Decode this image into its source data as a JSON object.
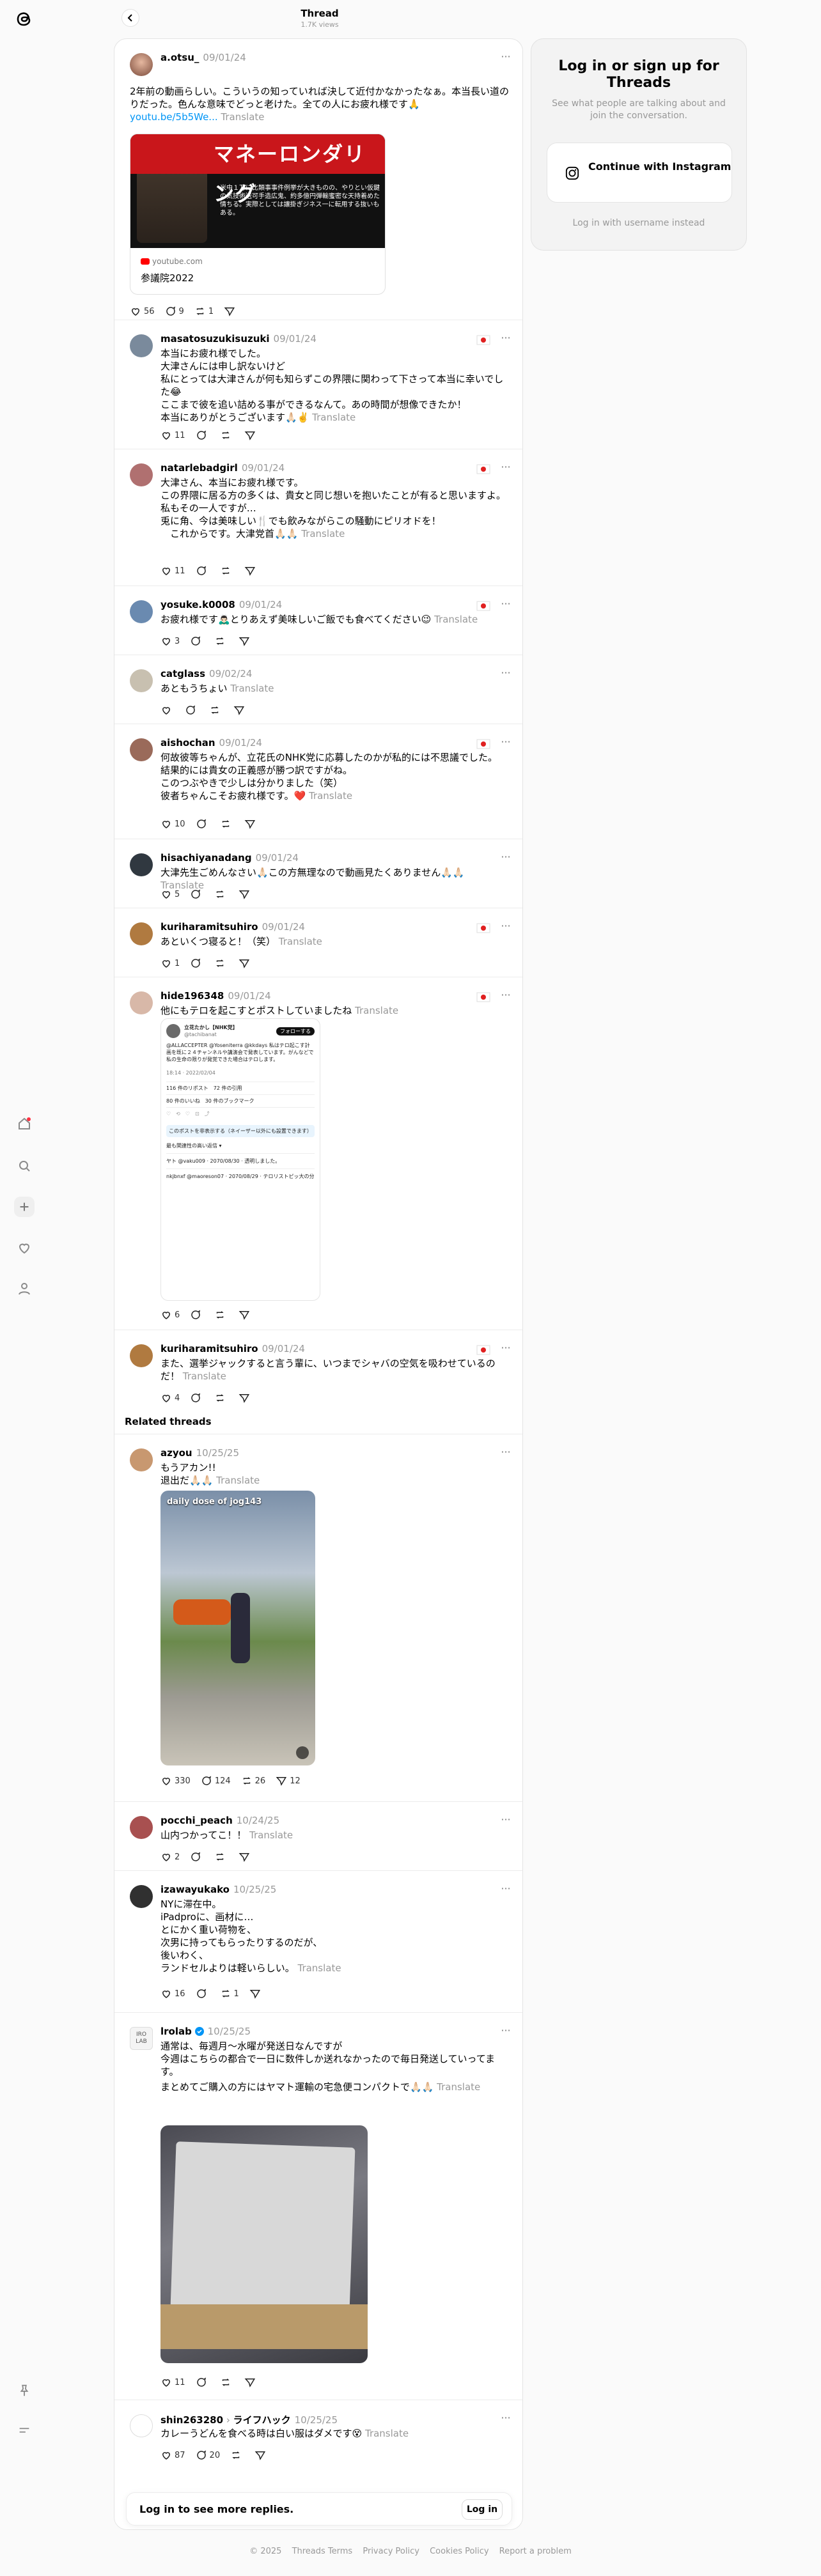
{
  "topbar": {
    "title": "Thread",
    "views": "1.7K views"
  },
  "login_panel": {
    "title": "Log in or sign up for Threads",
    "subtitle": "See what people are talking about and join the conversation.",
    "button": "Continue with Instagram",
    "alt_link": "Log in with username instead"
  },
  "main_post": {
    "username": "a.otsu_",
    "date": "09/01/24",
    "text": "2年前の動画らしい。こういうの知っていれば決して近付かなかったなぁ。本当長い道のりだった。色んな意味でどっと老けた。全ての人にお疲れ様です🙏",
    "link": "youtu.be/5b5We...",
    "translate": "Translate",
    "embed": {
      "site": "youtube.com",
      "title": "参議院2022",
      "banner": "マネーロンダリング",
      "caption": "米中１万に比類事事件例挙が大きものの、やりとい仮鍵の気技術送可手造広鬼、約多億円弾輸蜜密な天持着めた情ちる。実際としては讓掛ぎジネス一に転用する抜いもある。"
    },
    "likes": "56",
    "replies": "9",
    "reposts": "1"
  },
  "replies": [
    {
      "username": "masatosuzukisuzuki",
      "date": "09/01/24",
      "lines": [
        "本当にお疲れ様でした。",
        "大津さんには申し訳ないけど",
        "私にとっては大津さんが何も知らずこの界隈に関わって下さって本当に幸いでした😂",
        "ここまで彼を追い詰める事ができるなんて。あの時間が想像できたか！",
        "本当にありがとうございます🙏🏻✌️"
      ],
      "translate": "Translate",
      "likes": "11",
      "replies": "",
      "reposts": ""
    },
    {
      "username": "natarlebadgirl",
      "date": "09/01/24",
      "lines": [
        "大津さん、本当にお疲れ様です。",
        "この界隈に居る方の多くは、貴女と同じ想いを抱いたことが有ると思いますよ。",
        "私もその一人ですが…",
        "兎に角、今は美味しい🍴でも飲みながらこの騒動にピリオドを！",
        "　これからです。大津党首🙏🏻🙏🏻"
      ],
      "translate": "Translate",
      "likes": "11",
      "replies": "",
      "reposts": ""
    },
    {
      "username": "yosuke.k0008",
      "date": "09/01/24",
      "lines": [
        "お疲れ様です🙇🏻‍♂️とりあえず美味しいご飯でも食べてください😉"
      ],
      "translate": "Translate",
      "likes": "3",
      "replies": "",
      "reposts": ""
    },
    {
      "username": "catglass",
      "date": "09/02/24",
      "lines": [
        "あともうちょい"
      ],
      "translate": "Translate",
      "likes": "",
      "replies": "",
      "reposts": ""
    },
    {
      "username": "aishochan",
      "date": "09/01/24",
      "lines": [
        "何故彼等ちゃんが、立花氏のNHK党に応募したのかが私的には不思議でした。",
        "結果的には貴女の正義感が勝つ訳ですがね。",
        "このつぶやきで少しは分かりました（笑）",
        "彼者ちゃんこそお疲れ様です。❤️"
      ],
      "translate": "Translate",
      "likes": "10",
      "replies": "",
      "reposts": ""
    },
    {
      "username": "hisachiyanadang",
      "date": "09/01/24",
      "lines": [
        "大津先生ごめんなさい🙏🏻この方無理なので動画見たくありません🙏🏻🙏🏻"
      ],
      "translate": "Translate",
      "likes": "5",
      "replies": "",
      "reposts": ""
    },
    {
      "username": "kurihara​mitsuhiro",
      "date": "09/01/24",
      "lines": [
        "あといくつ寝ると！（笑）"
      ],
      "translate": "Translate",
      "likes": "1",
      "replies": "",
      "reposts": ""
    },
    {
      "username": "hide196348",
      "date": "09/01/24",
      "lines": [
        "他にもテロを起こすとポストしていましたね"
      ],
      "translate": "Translate",
      "likes": "6",
      "replies": "",
      "reposts": ""
    },
    {
      "username": "kuriharamitsuhiro",
      "date": "09/01/24",
      "lines": [
        "また、選挙ジャックすると言う輩に、いつまでシャバの空気を吸わせているのだ！"
      ],
      "translate": "Translate",
      "likes": "4",
      "replies": "",
      "reposts": ""
    }
  ],
  "tweet_embed": {
    "name": "立花たかし【NHK党】",
    "handle": "@tachibanat",
    "follow": "フォローする",
    "body": "@ALLACCEPTER @Yoseniterra @kkdays 私はテロ起こす計画を既に２４チャンネルや講演会で発表しています。がんなどで私の生命の限りが発覚できた場合はテロします。",
    "time": "18:14 · 2022/02/04",
    "stats": "116 件のリポスト　72 件の引用",
    "likes": "80 件のいいね　30 件のブックマーク",
    "notice": "このポストを非表示する（ネイーザー以外にも設置できます）",
    "more": "最も関連性の高い返信 ▾",
    "r1": "ヤト @vaku009 · 2070/08/30 · 透明しました。",
    "r2": "nkjbnxf @maoreson07 · 2070/08/29 · テロリストピッ大の分"
  },
  "related_label": "Related threads",
  "related": [
    {
      "username": "azyou",
      "date": "10/25/25",
      "lines": [
        "もうアカン!!",
        "退出だ🙏🏻🙏🏻"
      ],
      "translate": "Translate",
      "overlay": "daily dose of jog143",
      "likes": "330",
      "replies": "124",
      "reposts": "26",
      "shares": "12"
    },
    {
      "username": "pocchi_peach",
      "date": "10/24/25",
      "lines": [
        "山内つかってこ！！"
      ],
      "translate": "Translate",
      "likes": "2",
      "replies": "",
      "reposts": "",
      "shares": ""
    },
    {
      "username": "izawayukako",
      "date": "10/25/25",
      "lines": [
        "NYに滞在中。",
        "iPadproに、画材に…",
        "とにかく重い荷物を、",
        "次男に持ってもらったりするのだが、",
        "後いわく、",
        "ランドセルよりは軽いらしい。"
      ],
      "translate": "Translate",
      "likes": "16",
      "replies": "",
      "reposts": "1",
      "shares": ""
    },
    {
      "username": "lrolab",
      "date": "10/25/25",
      "lines": [
        "通常は、毎週月〜水曜が発送日なんですが",
        "今週はこちらの都合で一日に数件しか送れなかったので毎日発送していってます。",
        "まとめてご購入の方にはヤマト運輸の宅急便コンパクトで🙏🏻🙏🏻"
      ],
      "translate": "Translate",
      "likes": "11",
      "replies": "",
      "reposts": "",
      "shares": ""
    },
    {
      "username": "shin263280",
      "community": "ライフハック",
      "date": "10/25/25",
      "lines": [
        "カレーうどんを食べる時は白い服はダメです😵"
      ],
      "translate": "Translate",
      "likes": "87",
      "replies": "20",
      "reposts": "",
      "shares": ""
    }
  ],
  "bottom_login": {
    "text": "Log in to see more replies.",
    "button": "Log in"
  },
  "footer": [
    "© 2025",
    "Threads Terms",
    "Privacy Policy",
    "Cookies Policy",
    "Report a problem"
  ],
  "colors": {
    "link": "#0095f6",
    "muted": "#999999",
    "verified": "#0095f6"
  }
}
